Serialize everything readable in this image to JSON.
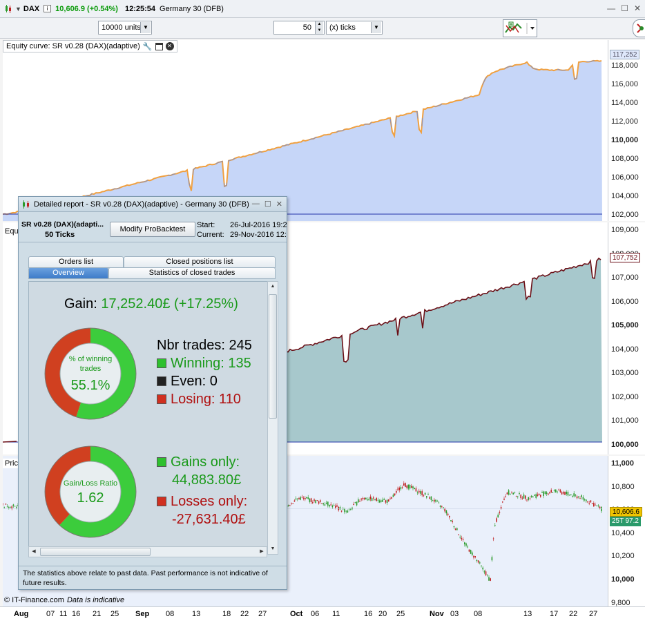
{
  "titlebar": {
    "symbol": "DAX",
    "price": "10,606.9 (+0.54%)",
    "time": "12:25:54",
    "instrument": "Germany 30 (DFB)"
  },
  "toolbar": {
    "units": "10000 units",
    "ticks_count": "50",
    "ticks_unit": "(x) ticks"
  },
  "panels": {
    "equity": {
      "label": "Equity curve: SR v0.28 (DAX)(adaptive)",
      "axis_ticks": [
        "118,000",
        "116,000",
        "114,000",
        "112,000",
        "110,000",
        "108,000",
        "106,000",
        "104,000",
        "102,000",
        "100,000"
      ],
      "current_label": "117,252"
    },
    "second": {
      "label": "Equi",
      "axis_ticks": [
        "109,000",
        "108,000",
        "107,000",
        "106,000",
        "105,000",
        "104,000",
        "103,000",
        "102,000",
        "101,000",
        "100,000"
      ],
      "current_label": "107,752"
    },
    "price": {
      "label": "Pric",
      "axis_ticks": [
        "11,000",
        "10,800",
        "10,600",
        "10,400",
        "10,200",
        "10,000",
        "9,800"
      ],
      "current_label": "10,606.6",
      "sub_label": "10,597.2",
      "ticks_label": "25T"
    }
  },
  "dates": [
    {
      "t": "Aug",
      "m": true
    },
    {
      "t": "07",
      "m": false
    },
    {
      "t": "11",
      "m": false
    },
    {
      "t": "16",
      "m": false
    },
    {
      "t": "21",
      "m": false
    },
    {
      "t": "25",
      "m": false
    },
    {
      "t": "Sep",
      "m": true
    },
    {
      "t": "08",
      "m": false
    },
    {
      "t": "13",
      "m": false
    },
    {
      "t": "18",
      "m": false
    },
    {
      "t": "22",
      "m": false
    },
    {
      "t": "27",
      "m": false
    },
    {
      "t": "Oct",
      "m": true
    },
    {
      "t": "06",
      "m": false
    },
    {
      "t": "11",
      "m": false
    },
    {
      "t": "16",
      "m": false
    },
    {
      "t": "20",
      "m": false
    },
    {
      "t": "25",
      "m": false
    },
    {
      "t": "Nov",
      "m": true
    },
    {
      "t": "03",
      "m": false
    },
    {
      "t": "08",
      "m": false
    },
    {
      "t": "13",
      "m": false
    },
    {
      "t": "17",
      "m": false
    },
    {
      "t": "22",
      "m": false
    },
    {
      "t": "27",
      "m": false
    }
  ],
  "footer": {
    "copyright": "© IT-Finance.com",
    "note": "Data is indicative"
  },
  "report": {
    "title": "Detailed report - SR v0.28 (DAX)(adaptive) - Germany 30 (DFB)",
    "strategy": "SR v0.28 (DAX)(adapti...",
    "ticks": "50 Ticks",
    "modify_button": "Modify ProBacktest",
    "start_label": "Start:",
    "start_value": "26-Jul-2016 19:2",
    "current_label": "Current:",
    "current_value": "29-Nov-2016 12:2",
    "tabs": {
      "orders": "Orders list",
      "closed_positions": "Closed positions list",
      "overview": "Overview",
      "statistics": "Statistics of closed trades"
    },
    "gain_label": "Gain:",
    "gain_value": "17,252.40£ (+17.25%)",
    "nbr_trades": "Nbr trades: 245",
    "winning": "Winning: 135",
    "even": "Even: 0",
    "losing": "Losing: 110",
    "win_donut": {
      "label": "% of winning trades",
      "value": "55.1%",
      "fraction": 0.551
    },
    "ratio_donut": {
      "label": "Gain/Loss Ratio",
      "value": "1.62",
      "fraction": 0.619
    },
    "gains_only_label": "Gains only:",
    "gains_only_value": "44,883.80£",
    "losses_only_label": "Losses only:",
    "losses_only_value": "-27,631.40£",
    "disclaimer": "The statistics above relate to past data. Past performance is not indicative of future results."
  },
  "colors": {
    "green": "#1a9a1a",
    "red": "#b01010",
    "equity_fill": "#c6d6f8",
    "equity_line": "#f0a040",
    "second_fill": "#a7c8cc",
    "second_line": "#6a0f16"
  }
}
